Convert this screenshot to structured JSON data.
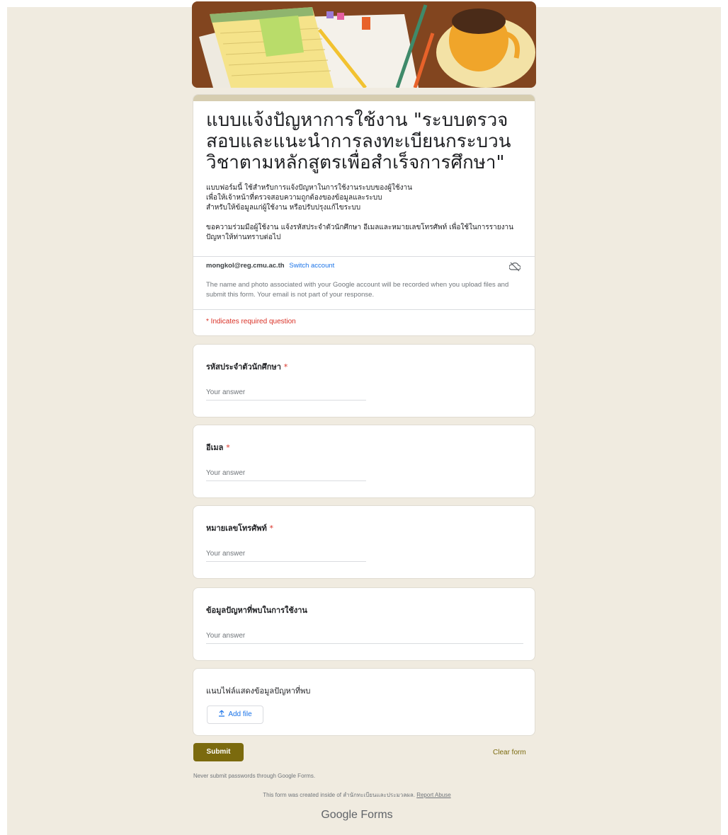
{
  "form": {
    "title": "แบบแจ้งปัญหาการใช้งาน \"ระบบตรวจสอบและแนะนำการลงทะเบียนกระบวนวิชาตามหลักสูตรเพื่อสำเร็จการศึกษา\"",
    "description_lines": [
      "แบบฟอร์มนี้ ใช้สำหรับการแจ้งปัญหาในการใช้งานระบบของผู้ใช้งาน",
      "เพื่อให้เจ้าหน้าที่ตรวจสอบความถูกต้องของข้อมูลและระบบ",
      "สำหรับให้ข้อมูลแก่ผู้ใช้งาน หรือปรับปรุงแก้ไขระบบ",
      "ขอความร่วมมือผู้ใช้งาน แจ้งรหัสประจำตัวนักศึกษา อีเมลและหมายเลขโทรศัพท์ เพื่อใช้ในการรายงานปัญหาให้ท่านทราบต่อไป"
    ]
  },
  "account": {
    "email": "mongkol@reg.cmu.ac.th",
    "switch_label": "Switch account",
    "notice": "The name and photo associated with your Google account will be recorded when you upload files and submit this form. Your email is not part of your response.",
    "cloud_icon": "cloud-off-icon"
  },
  "required_note": "* Indicates required question",
  "questions": [
    {
      "label": "รหัสประจำตัวนักศึกษา",
      "required": "*",
      "placeholder": "Your answer"
    },
    {
      "label": "อีเมล",
      "required": "*",
      "placeholder": "Your answer"
    },
    {
      "label": "หมายเลขโทรศัพท์",
      "required": "*",
      "placeholder": "Your answer"
    },
    {
      "label": "ข้อมูลปัญหาที่พบในการใช้งาน",
      "placeholder": "Your answer"
    }
  ],
  "upload": {
    "label": "แนบไฟล์แสดงข้อมูลปัญหาที่พบ",
    "button_label": "Add file",
    "icon": "upload-icon"
  },
  "actions": {
    "submit_label": "Submit",
    "clear_label": "Clear form"
  },
  "footer": {
    "never_submit": "Never submit passwords through Google Forms.",
    "created_text": "This form was created inside of สำนักทะเบียนและประมวลผล.",
    "report_abuse": "Report Abuse",
    "brand": "Google Forms"
  },
  "colors": {
    "accent": "#7b6a0e",
    "link": "#1a73e8",
    "required": "#d93025",
    "background": "#f0ebe0"
  }
}
